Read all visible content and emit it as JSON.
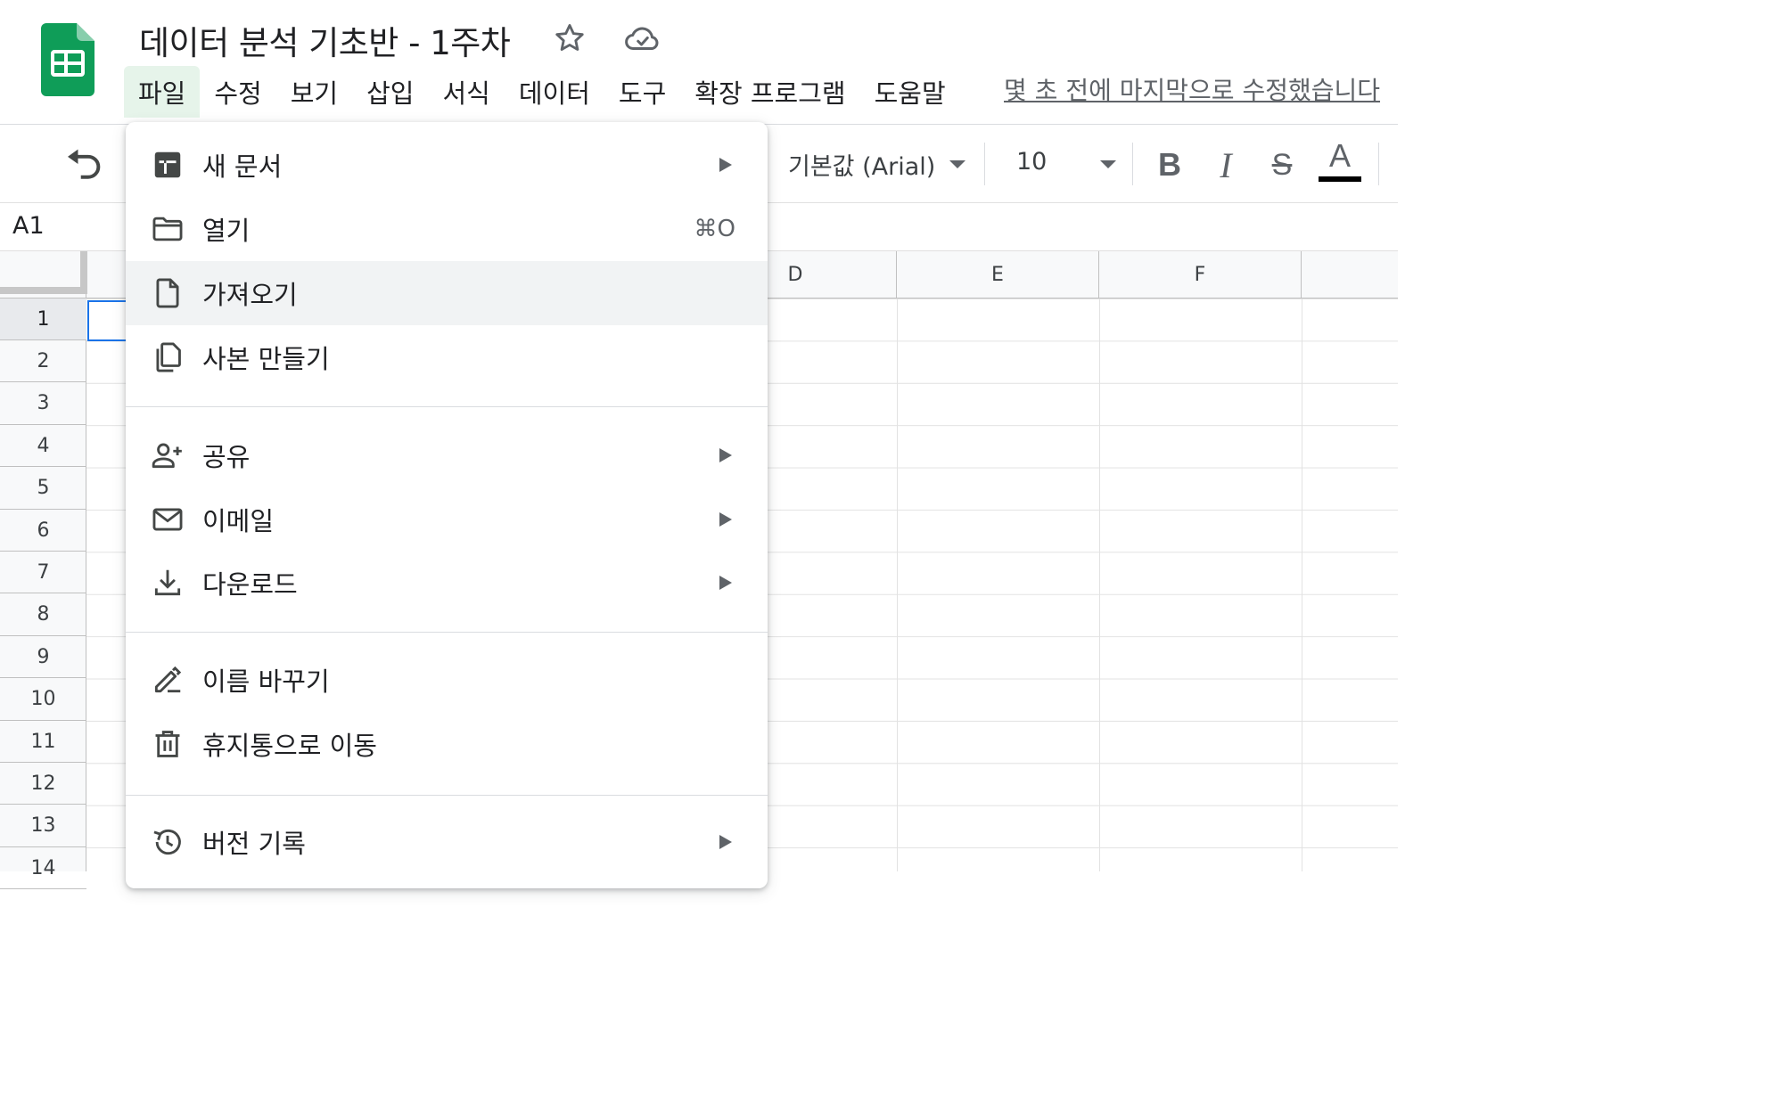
{
  "app": {
    "doc_title": "데이터 분석 기초반 - 1주차",
    "last_edit": "몇 초 전에 마지막으로 수정했습니다"
  },
  "menubar": {
    "items": [
      {
        "label": "파일",
        "active": true
      },
      {
        "label": "수정"
      },
      {
        "label": "보기"
      },
      {
        "label": "삽입"
      },
      {
        "label": "서식"
      },
      {
        "label": "데이터"
      },
      {
        "label": "도구"
      },
      {
        "label": "확장 프로그램"
      },
      {
        "label": "도움말"
      }
    ]
  },
  "toolbar": {
    "font_family": "기본값 (Arial)",
    "font_size": "10",
    "bold_label": "B",
    "italic_label": "I",
    "strike_label": "S",
    "text_color_label": "A"
  },
  "formula": {
    "cell_ref": "A1"
  },
  "grid": {
    "columns": [
      "D",
      "E",
      "F"
    ],
    "rows": [
      "1",
      "2",
      "3",
      "4",
      "5",
      "6",
      "7",
      "8",
      "9",
      "10",
      "11",
      "12",
      "13",
      "14"
    ],
    "selected_row": "1"
  },
  "file_menu": {
    "items": [
      {
        "label": "새 문서",
        "icon": "new-sheet-icon",
        "submenu": true
      },
      {
        "label": "열기",
        "icon": "folder-icon",
        "shortcut": "⌘O"
      },
      {
        "label": "가져오기",
        "icon": "file-icon",
        "hovered": true
      },
      {
        "label": "사본 만들기",
        "icon": "copy-icon"
      },
      {
        "label": "공유",
        "icon": "person-add-icon",
        "submenu": true
      },
      {
        "label": "이메일",
        "icon": "mail-icon",
        "submenu": true
      },
      {
        "label": "다운로드",
        "icon": "download-icon",
        "submenu": true
      },
      {
        "label": "이름 바꾸기",
        "icon": "rename-icon"
      },
      {
        "label": "휴지통으로 이동",
        "icon": "trash-icon"
      },
      {
        "label": "버전 기록",
        "icon": "history-icon",
        "submenu": true
      }
    ]
  },
  "colors": {
    "brand_green": "#0f9d58",
    "menu_active_bg": "#e6f4ea",
    "selection_blue": "#1a73e8",
    "hover_bg": "#f1f3f4"
  }
}
